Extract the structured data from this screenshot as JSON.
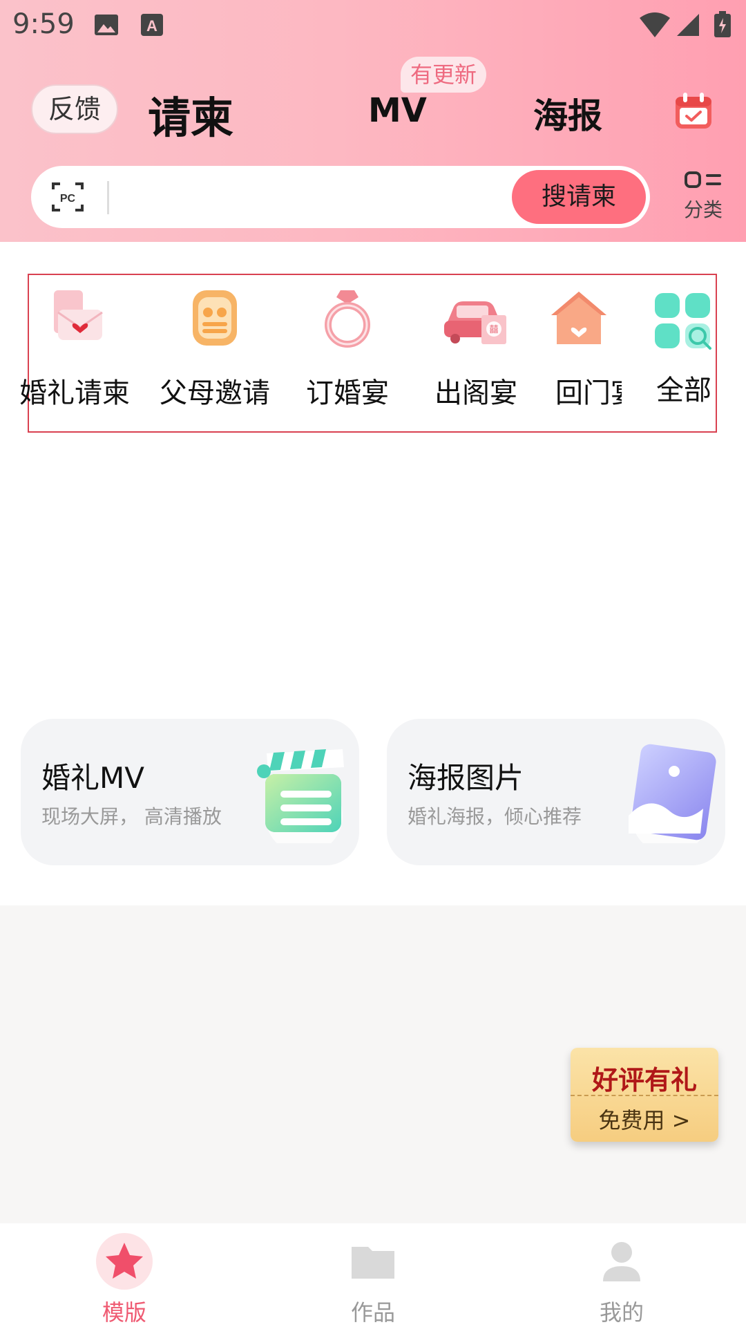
{
  "status_bar": {
    "time": "9:59",
    "icons": [
      "image-icon",
      "a-icon",
      "wifi-icon",
      "signal-icon",
      "battery-icon"
    ]
  },
  "header": {
    "feedback_label": "反馈",
    "tabs": [
      {
        "label": "请柬",
        "active": true
      },
      {
        "label": "MV",
        "badge": "有更新"
      },
      {
        "label": "海报"
      }
    ],
    "calendar_icon": "calendar-check-icon"
  },
  "search": {
    "placeholder": "",
    "scan_icon": "pc-scan-icon",
    "button_label": "搜请柬",
    "category_label": "分类"
  },
  "categories": [
    {
      "label": "婚礼请柬",
      "icon": "envelope-heart-icon"
    },
    {
      "label": "父母邀请",
      "icon": "parents-icon"
    },
    {
      "label": "订婚宴",
      "icon": "ring-icon"
    },
    {
      "label": "出阁宴",
      "icon": "wedding-car-icon"
    },
    {
      "label": "回门宴",
      "icon": "house-heart-icon"
    },
    {
      "label": "全部",
      "icon": "grid-search-icon"
    }
  ],
  "cards": [
    {
      "title": "婚礼MV",
      "subtitle": "现场大屏， 高清播放",
      "icon": "clapperboard-icon"
    },
    {
      "title": "海报图片",
      "subtitle": "婚礼海报，倾心推荐",
      "icon": "picture-icon"
    }
  ],
  "review_promo": {
    "title": "好评有礼",
    "subtitle": "免费用 >"
  },
  "bottom_nav": [
    {
      "label": "模版",
      "icon": "star-icon",
      "active": true
    },
    {
      "label": "作品",
      "icon": "folder-icon"
    },
    {
      "label": "我的",
      "icon": "user-icon"
    }
  ],
  "colors": {
    "accent": "#fe6f7f",
    "header_start": "#fbc2ca",
    "header_end": "#ff9fb1",
    "active_nav": "#ef5a72"
  }
}
